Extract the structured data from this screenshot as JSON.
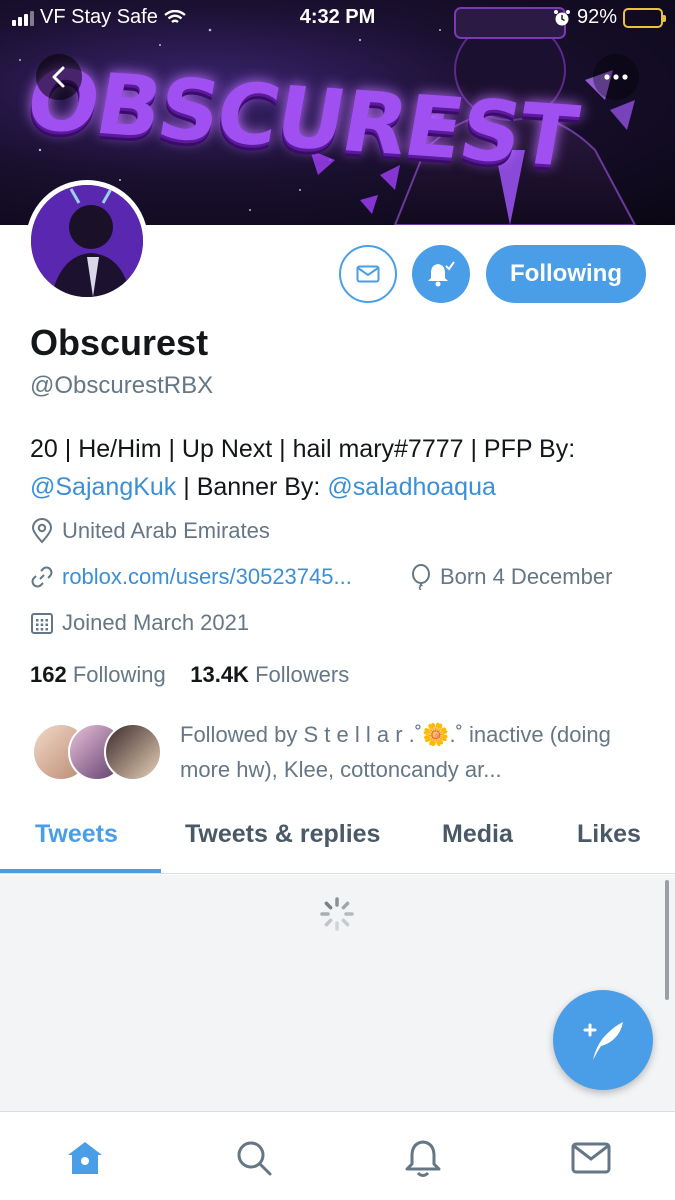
{
  "status_bar": {
    "carrier": "VF Stay Safe",
    "time": "4:32 PM",
    "battery": "92%"
  },
  "banner": {
    "title": "OBSCUREST"
  },
  "profile": {
    "name": "Obscurest",
    "handle": "@ObscurestRBX",
    "bio_text_1": "20 | He/Him | Up Next | hail mary#7777 | PFP By:",
    "bio_link_1": "@SajangKuk",
    "bio_text_2": " | Banner By: ",
    "bio_link_2": "@saladhoaqua",
    "location": "United Arab Emirates",
    "website": "roblox.com/users/30523745...",
    "birthday": "Born 4 December",
    "joined": "Joined March 2021",
    "following_count": "162",
    "following_label": "Following",
    "followers_count": "13.4K",
    "followers_label": "Followers",
    "followed_by": "Followed by S t e l l a r .˚🌼.˚ inactive (doing more hw), Klee, cottoncandy ar..."
  },
  "actions": {
    "following_button": "Following"
  },
  "tabs": [
    {
      "label": "Tweets",
      "active": true
    },
    {
      "label": "Tweets & replies",
      "active": false
    },
    {
      "label": "Media",
      "active": false
    },
    {
      "label": "Likes",
      "active": false
    }
  ],
  "colors": {
    "accent": "#4a9ee8",
    "text": "#14171a",
    "muted": "#657786"
  },
  "icons": {
    "nav": [
      "home-icon",
      "search-icon",
      "notifications-icon",
      "messages-icon"
    ],
    "fab": "compose-tweet-icon"
  }
}
